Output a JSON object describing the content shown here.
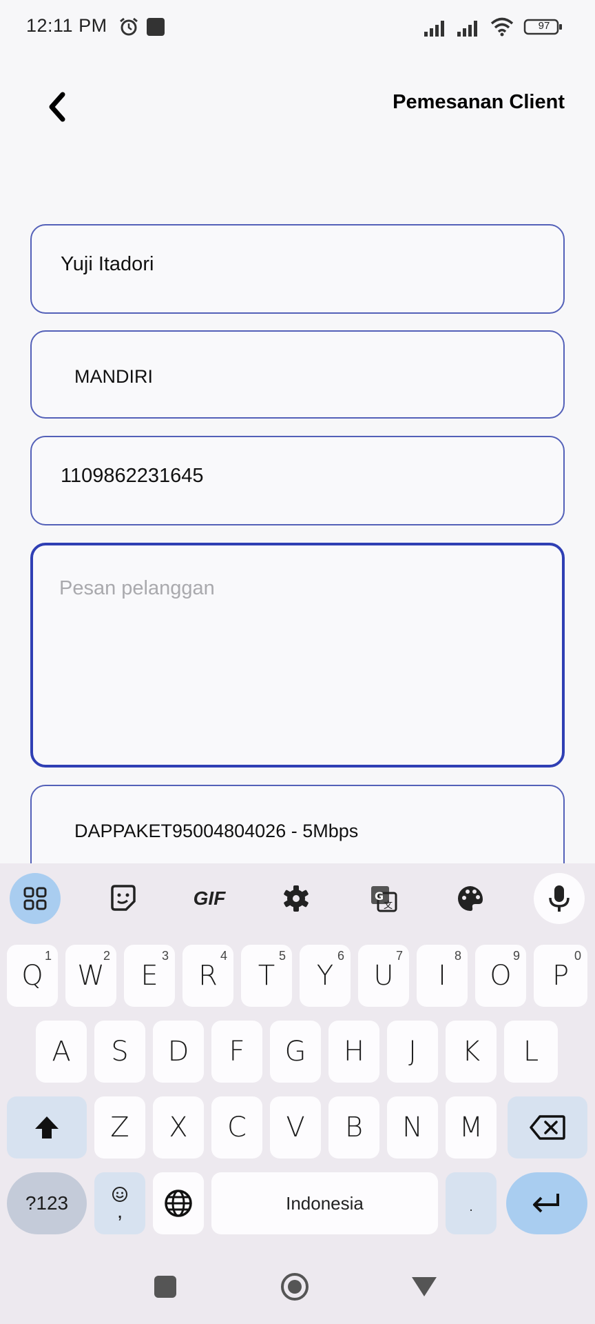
{
  "status_bar": {
    "time": "12:11 PM",
    "battery": "97",
    "icons": [
      "alarm-icon",
      "stop-icon",
      "signal-icon",
      "signal-icon",
      "wifi-icon",
      "battery-icon"
    ]
  },
  "header": {
    "title": "Pemesanan Client",
    "back_icon": "chevron-left-icon"
  },
  "form": {
    "name_value": "Yuji Itadori",
    "bank_value": "MANDIRI",
    "account_value": "1109862231645",
    "message_placeholder": "Pesan pelanggan",
    "message_value": "",
    "package_value": "DAPPAKET95004804026 - 5Mbps"
  },
  "keyboard": {
    "toolbar": [
      "apps-grid-icon",
      "sticker-icon",
      "gif-icon",
      "settings-icon",
      "translate-icon",
      "palette-icon",
      "mic-icon"
    ],
    "gif_label": "GIF",
    "row1": [
      {
        "label": "Q",
        "sup": "1"
      },
      {
        "label": "W",
        "sup": "2"
      },
      {
        "label": "E",
        "sup": "3"
      },
      {
        "label": "R",
        "sup": "4"
      },
      {
        "label": "T",
        "sup": "5"
      },
      {
        "label": "Y",
        "sup": "6"
      },
      {
        "label": "U",
        "sup": "7"
      },
      {
        "label": "I",
        "sup": "8"
      },
      {
        "label": "O",
        "sup": "9"
      },
      {
        "label": "P",
        "sup": "0"
      }
    ],
    "row2": [
      "A",
      "S",
      "D",
      "F",
      "G",
      "H",
      "J",
      "K",
      "L"
    ],
    "row3": [
      "Z",
      "X",
      "C",
      "V",
      "B",
      "N",
      "M"
    ],
    "symbols_label": "?123",
    "comma_label": ",",
    "space_label": "Indonesia",
    "period_label": ".",
    "accent_color": "#a9cdf0"
  },
  "nav": {
    "icons": [
      "recents-square-icon",
      "home-circle-icon",
      "back-triangle-icon"
    ]
  }
}
